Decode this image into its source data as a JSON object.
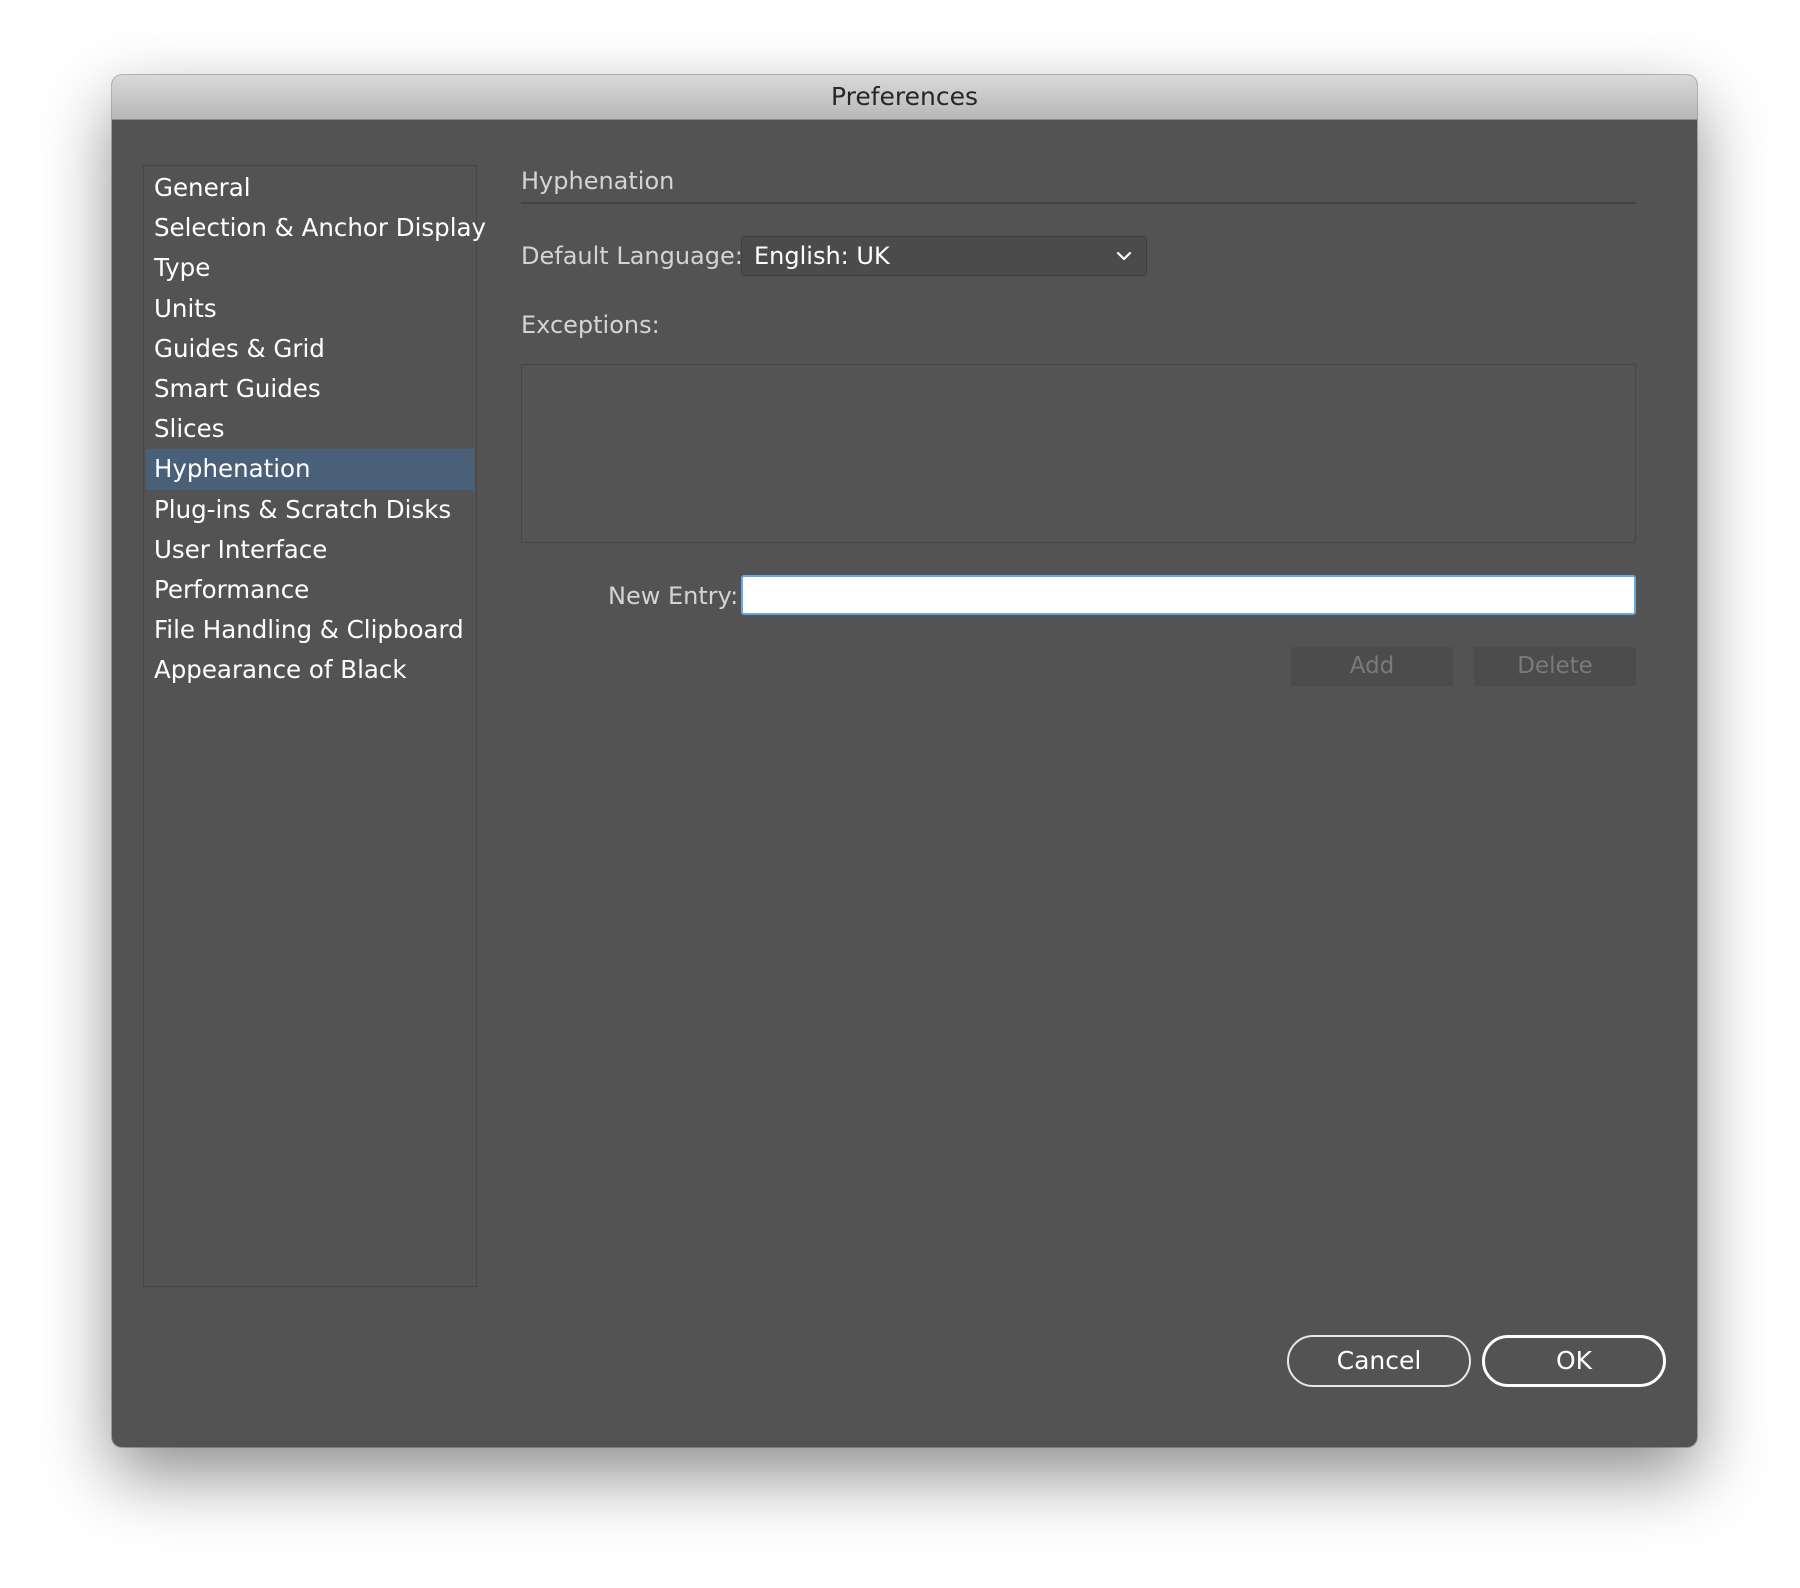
{
  "window": {
    "title": "Preferences"
  },
  "sidebar": {
    "items": [
      {
        "label": "General"
      },
      {
        "label": "Selection & Anchor Display"
      },
      {
        "label": "Type"
      },
      {
        "label": "Units"
      },
      {
        "label": "Guides & Grid"
      },
      {
        "label": "Smart Guides"
      },
      {
        "label": "Slices"
      },
      {
        "label": "Hyphenation",
        "selected": true
      },
      {
        "label": "Plug-ins & Scratch Disks"
      },
      {
        "label": "User Interface"
      },
      {
        "label": "Performance"
      },
      {
        "label": "File Handling & Clipboard"
      },
      {
        "label": "Appearance of Black"
      }
    ]
  },
  "panel": {
    "title": "Hyphenation",
    "default_language_label": "Default Language:",
    "default_language_value": "English: UK",
    "exceptions_label": "Exceptions:",
    "exceptions": [],
    "new_entry_label": "New Entry:",
    "new_entry_value": "",
    "add_label": "Add",
    "delete_label": "Delete"
  },
  "footer": {
    "cancel_label": "Cancel",
    "ok_label": "OK"
  },
  "icons": {
    "dropdown": "chevron-down-icon"
  },
  "colors": {
    "panel_bg": "#535353",
    "selection": "#4a5f78",
    "focus_ring": "#6aa6e0"
  }
}
